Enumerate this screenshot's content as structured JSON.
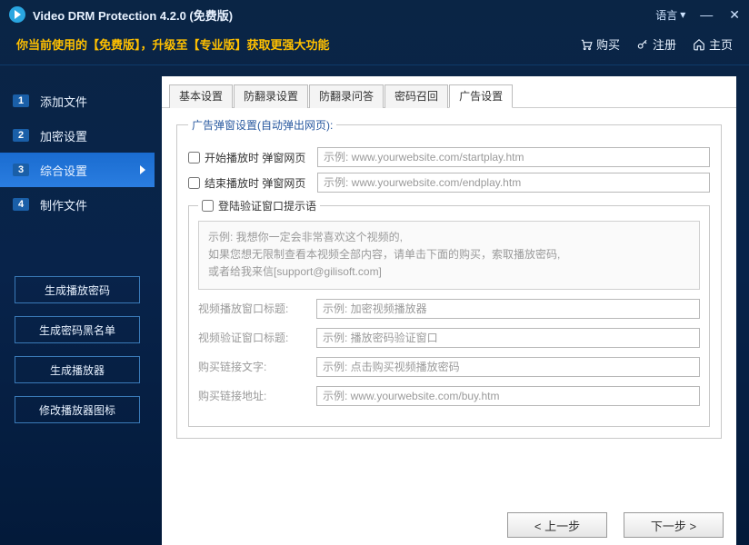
{
  "window": {
    "title": "Video DRM Protection 4.2.0 (免费版)",
    "language_label": "语言"
  },
  "toolbar": {
    "tagline": "你当前使用的【免费版】，升级至【专业版】获取更强大功能",
    "buy": "购买",
    "register": "注册",
    "home": "主页"
  },
  "sidebar": {
    "steps": [
      {
        "num": "1",
        "label": "添加文件"
      },
      {
        "num": "2",
        "label": "加密设置"
      },
      {
        "num": "3",
        "label": "综合设置"
      },
      {
        "num": "4",
        "label": "制作文件"
      }
    ],
    "buttons": {
      "gen_password": "生成播放密码",
      "gen_blacklist": "生成密码黑名单",
      "gen_player": "生成播放器",
      "modify_icon": "修改播放器图标"
    }
  },
  "tabs": {
    "basic": "基本设置",
    "anti_record": "防翻录设置",
    "anti_record_qa": "防翻录问答",
    "password_recall": "密码召回",
    "ad": "广告设置"
  },
  "ad": {
    "group_label": "广告弹窗设置(自动弹出网页):",
    "start_label": "开始播放时 弹窗网页",
    "start_placeholder": "示例: www.yourwebsite.com/startplay.htm",
    "end_label": "结束播放时 弹窗网页",
    "end_placeholder": "示例: www.yourwebsite.com/endplay.htm",
    "login_hint_label": "登陆验证窗口提示语",
    "hint_line1": "示例: 我想你一定会非常喜欢这个视频的,",
    "hint_line2": "如果您想无限制查看本视频全部内容，请单击下面的购买，索取播放密码,",
    "hint_line3": "或者给我来信[support@gilisoft.com]",
    "player_title_label": "视频播放窗口标题:",
    "player_title_placeholder": "示例: 加密视频播放器",
    "verify_title_label": "视频验证窗口标题:",
    "verify_title_placeholder": "示例: 播放密码验证窗口",
    "buy_text_label": "购买链接文字:",
    "buy_text_placeholder": "示例: 点击购买视频播放密码",
    "buy_url_label": "购买链接地址:",
    "buy_url_placeholder": "示例: www.yourwebsite.com/buy.htm"
  },
  "nav": {
    "prev": "< 上一步",
    "next": "下一步 >"
  }
}
